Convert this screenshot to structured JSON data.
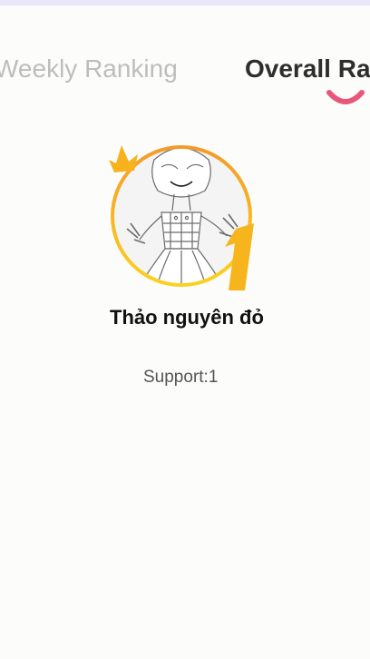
{
  "tabs": [
    {
      "label": "Weekly Ranking",
      "active": false
    },
    {
      "label": "Overall Ranking",
      "active": true
    }
  ],
  "ranking": {
    "rank": "1",
    "user_name": "Thảo nguyên đỏ",
    "support_label": "Support:",
    "support_value": "1"
  },
  "icons": {
    "crown": "crown-icon",
    "rank_badge": "rank-1-badge-icon",
    "tab_indicator": "smile-underline-icon"
  },
  "colors": {
    "accent_pink": "#e8567a",
    "gold": "#f7b21e",
    "orange": "#f08a24",
    "active_tab_text": "#2e2e2e",
    "inactive_tab_text": "#bdbdbd"
  }
}
